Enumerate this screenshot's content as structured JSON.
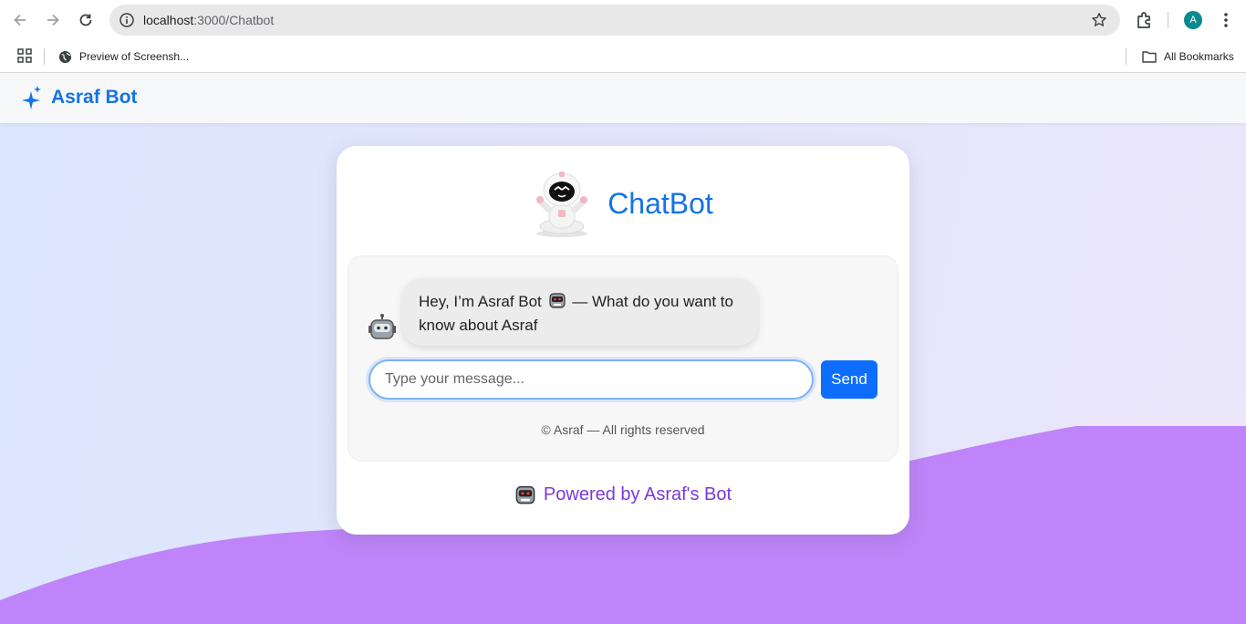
{
  "browser": {
    "url_host": "localhost",
    "url_path": ":3000/Chatbot",
    "profile_initial": "A",
    "bookmarks": [
      {
        "label": "Preview of Screensh..."
      }
    ],
    "all_bookmarks_label": "All Bookmarks"
  },
  "navbar": {
    "brand": "Asraf Bot"
  },
  "card": {
    "title": "ChatBot",
    "messages": [
      {
        "sender": "bot",
        "text_before": "Hey, I’m Asraf Bot",
        "text_after": "— What do you want to know about Asraf"
      }
    ],
    "input": {
      "value": "",
      "placeholder": "Type your message..."
    },
    "send_label": "Send",
    "copyright": "© Asraf — All rights reserved",
    "powered_by": "Powered by Asraf's Bot"
  },
  "colors": {
    "accent": "#1473e6",
    "send_button": "#0d6efd",
    "powered": "#7b39d8",
    "wave": "#bf84f9"
  }
}
